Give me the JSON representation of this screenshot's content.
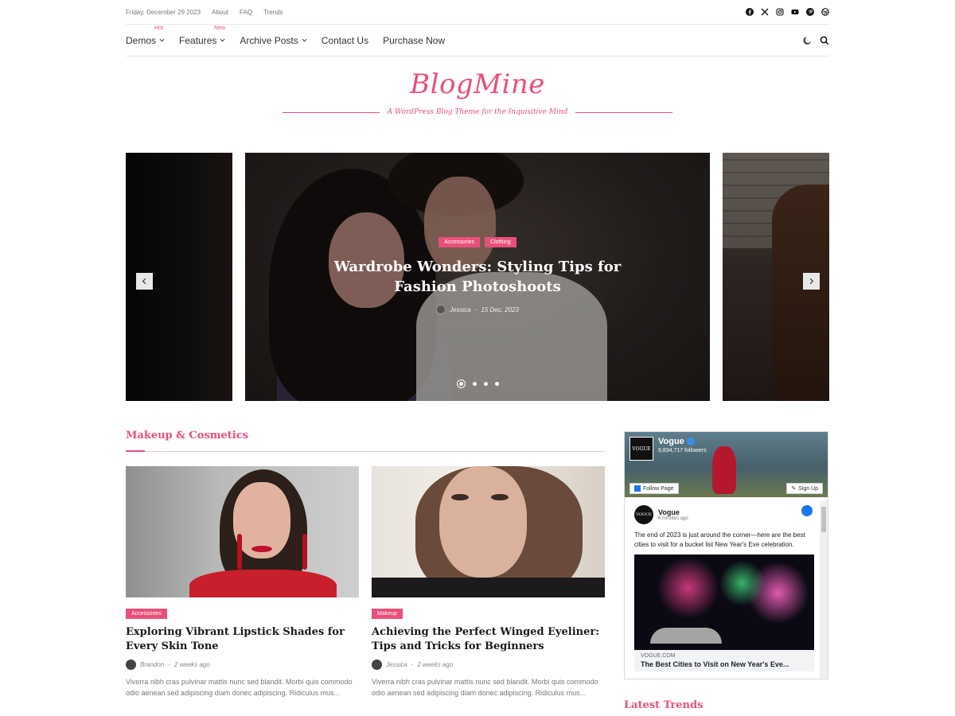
{
  "topbar": {
    "date": "Friday, December 29 2023",
    "links": [
      "About",
      "FAQ",
      "Trends"
    ],
    "social_icons": [
      "facebook-icon",
      "x-icon",
      "instagram-icon",
      "youtube-icon",
      "pinterest-icon",
      "dribbble-icon"
    ]
  },
  "nav": {
    "items": [
      {
        "label": "Demos",
        "tag": "Hot",
        "has_dropdown": true
      },
      {
        "label": "Features",
        "tag": "New",
        "has_dropdown": true
      },
      {
        "label": "Archive Posts",
        "tag": "",
        "has_dropdown": true
      },
      {
        "label": "Contact Us",
        "tag": "",
        "has_dropdown": false
      },
      {
        "label": "Purchase Now",
        "tag": "",
        "has_dropdown": false
      }
    ],
    "tools": [
      "moon-icon",
      "search-icon"
    ]
  },
  "brand": {
    "logo": "BlogMine",
    "tagline": "A WordPress Blog Theme for the Inquisitive Mind",
    "accent_color": "#e8507a"
  },
  "slider": {
    "categories": [
      "Accessories",
      "Clothing"
    ],
    "title": "Wardrobe Wonders: Styling Tips for Fashion Photoshoots",
    "author": "Jessica",
    "separator": "-",
    "date": "15 Dec, 2023",
    "dots_count": 4,
    "active_dot": 1
  },
  "section": {
    "title": "Makeup & Cosmetics",
    "cards": [
      {
        "category": "Accessories",
        "title": "Exploring Vibrant Lipstick Shades for Every Skin Tone",
        "author": "Brandon",
        "separator": "-",
        "time": "2 weeks ago",
        "excerpt": "Viverra nibh cras pulvinar mattis nunc sed blandit. Morbi quis commodo odio aenean sed adipiscing diam donec adipiscing. Ridiculus mus..."
      },
      {
        "category": "Makeup",
        "title": "Achieving the Perfect Winged Eyeliner: Tips and Tricks for Beginners",
        "author": "Jessica",
        "separator": "-",
        "time": "2 weeks ago",
        "excerpt": "Viverra nibh cras pulvinar mattis nunc sed blandit. Morbi quis commodo odio aenean sed adipiscing diam donec adipiscing. Ridiculus mus..."
      }
    ]
  },
  "sidebar": {
    "facebook": {
      "page_name": "Vogue",
      "followers": "9,834,717 followers",
      "page_logo": "VOGUE",
      "follow_label": "Follow Page",
      "signup_label": "Sign Up",
      "post_author": "Vogue",
      "post_time": "6 minutes ago",
      "post_text": "The end of 2023 is just around the corner—here are the best cities to visit for a bucket list New Year's Eve celebration.",
      "link_domain": "VOGUE.COM",
      "link_title": "The Best Cities to Visit on New Year's Eve..."
    },
    "latest_title": "Latest Trends"
  }
}
